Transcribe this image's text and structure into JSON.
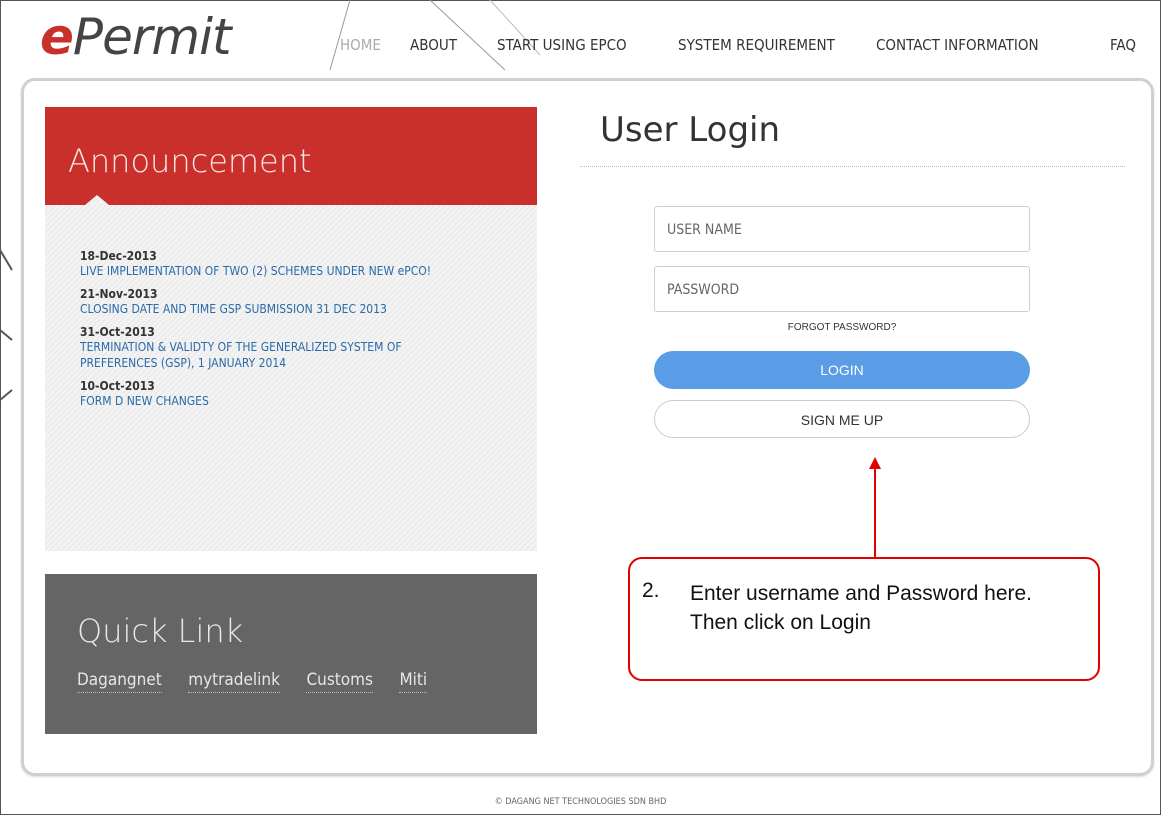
{
  "logo": {
    "prefix": "e",
    "rest": "Permit"
  },
  "nav": [
    "HOME",
    "ABOUT",
    "START USING EPCO",
    "SYSTEM REQUIREMENT",
    "CONTACT INFORMATION",
    "FAQ"
  ],
  "announcement": {
    "title": "Announcement",
    "items": [
      {
        "date": "18-Dec-2013",
        "text": "LIVE IMPLEMENTATION OF TWO (2) SCHEMES UNDER NEW ePCO!"
      },
      {
        "date": "21-Nov-2013",
        "text": "CLOSING DATE AND TIME GSP SUBMISSION 31 DEC 2013"
      },
      {
        "date": "31-Oct-2013",
        "text": "TERMINATION & VALIDTY OF THE GENERALIZED SYSTEM OF PREFERENCES (GSP), 1 JANUARY 2014"
      },
      {
        "date": "10-Oct-2013",
        "text": "FORM D NEW CHANGES"
      }
    ]
  },
  "quicklink": {
    "title": "Quick Link",
    "links": [
      "Dagangnet",
      "mytradelink",
      "Customs",
      "Miti"
    ]
  },
  "login": {
    "title": "User Login",
    "username_placeholder": "USER NAME",
    "password_placeholder": "PASSWORD",
    "forgot": "FORGOT PASSWORD?",
    "login_button": "LOGIN",
    "signup_button": "SIGN ME UP"
  },
  "callout": {
    "number": "2.",
    "text": "Enter username and Password here. Then click on Login",
    "color": "#e00000"
  },
  "footer": "© DAGANG NET TECHNOLOGIES SDN BHD",
  "colors": {
    "brand_red": "#c9302c",
    "login_blue": "#5b9ce6",
    "quicklink_gray": "#656565"
  }
}
